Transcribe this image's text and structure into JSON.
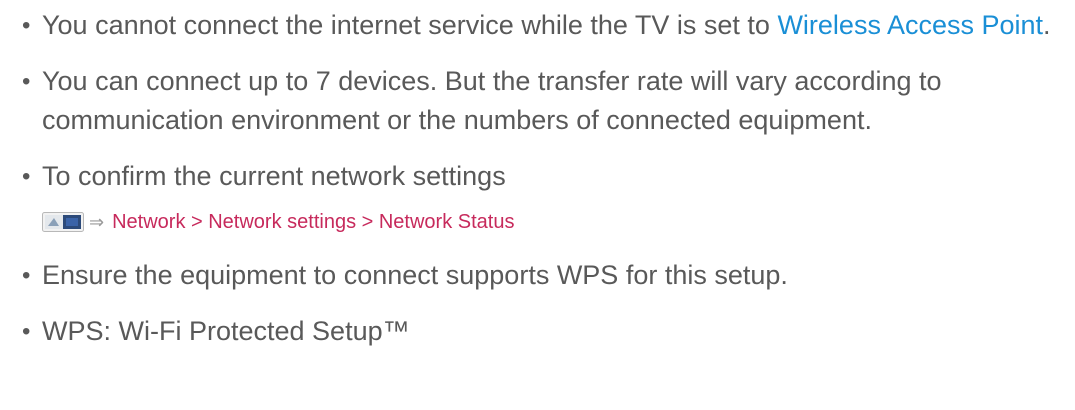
{
  "colors": {
    "text": "#595959",
    "link": "#1a8fd6",
    "menu_path": "#c72a5c"
  },
  "bullets": [
    {
      "before": "You cannot connect the internet service while the TV is set to ",
      "link": "Wireless Access Point",
      "after": "."
    },
    {
      "text": "You can connect up to 7 devices. But the transfer rate will vary according to communication environment or the numbers of connected equipment."
    },
    {
      "text": "To confirm the current network settings"
    },
    {
      "text": "Ensure the equipment to connect supports WPS for this setup."
    },
    {
      "text": "WPS: Wi-Fi Protected Setup™"
    }
  ],
  "menu_path": {
    "icon": "menu-icon",
    "arrow": "⇒",
    "text": "Network > Network settings > Network Status"
  }
}
